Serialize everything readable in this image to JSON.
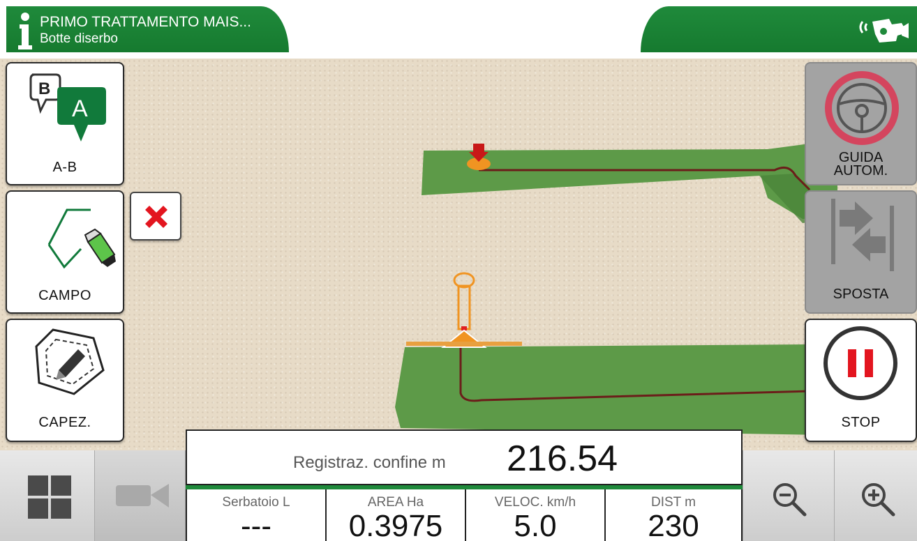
{
  "header": {
    "title": "PRIMO TRATTAMENTO MAIS...",
    "subtitle": "Botte diserbo",
    "info_icon": "info-icon",
    "gps_icon": "gps-signal-icon",
    "accent_color": "#1f8a3b"
  },
  "left_toolbar": {
    "ab": {
      "label": "A-B",
      "icon": "ab-line-icon",
      "marker_a": "A",
      "marker_b": "B"
    },
    "campo": {
      "label": "CAMPO",
      "icon": "field-draw-icon"
    },
    "capez": {
      "label": "CAPEZ.",
      "icon": "headland-icon"
    },
    "cancel_icon": "close-icon"
  },
  "right_toolbar": {
    "guida": {
      "label_line1": "GUIDA",
      "label_line2": "AUTOM.",
      "icon": "steering-wheel-icon"
    },
    "sposta": {
      "label": "SPOSTA",
      "icon": "shift-arrows-icon"
    },
    "stop": {
      "label": "STOP",
      "icon": "pause-icon"
    }
  },
  "readout": {
    "label": "Registraz. confine m",
    "value": "216.54"
  },
  "stats": [
    {
      "label": "Serbatoio L",
      "value": "---"
    },
    {
      "label": "AREA Ha",
      "value": "0.3975"
    },
    {
      "label": "VELOC. km/h",
      "value": "5.0"
    },
    {
      "label": "DIST m",
      "value": "230"
    }
  ],
  "bottom_buttons": {
    "menu": "grid-menu-icon",
    "camera": "camera-icon",
    "zoom_out": "zoom-out-icon",
    "zoom_in": "zoom-in-icon"
  }
}
